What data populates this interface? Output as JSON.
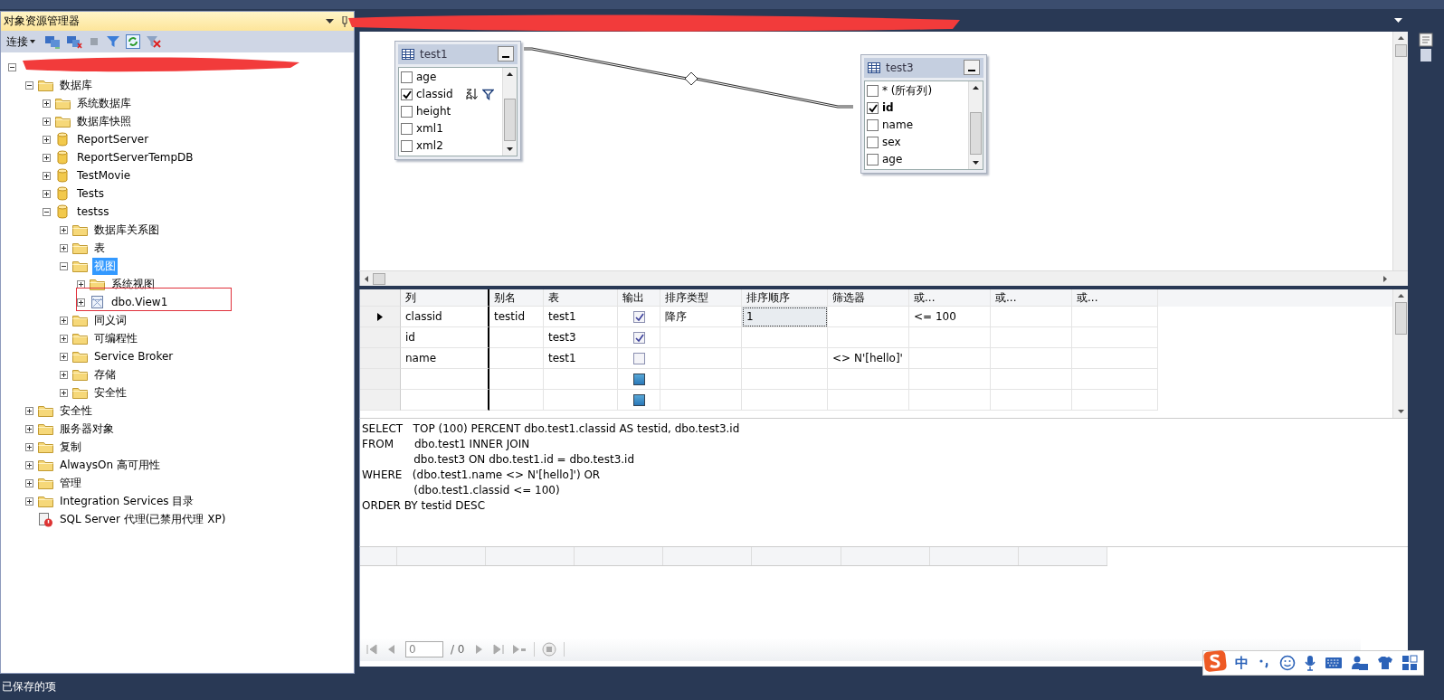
{
  "explorer": {
    "title": "对象资源管理器",
    "connect_label": "连接",
    "tree": [
      {
        "expanded": true,
        "children": [
          {
            "kind": "folder",
            "label": "数据库",
            "expanded": true,
            "selected": false,
            "children": [
              {
                "kind": "folder",
                "label": "系统数据库",
                "expanded": false,
                "selected": false
              },
              {
                "kind": "folder",
                "label": "数据库快照",
                "expanded": false,
                "selected": false
              },
              {
                "kind": "database",
                "label": "ReportServer",
                "expanded": false,
                "selected": false
              },
              {
                "kind": "database",
                "label": "ReportServerTempDB",
                "expanded": false,
                "selected": false
              },
              {
                "kind": "database",
                "label": "TestMovie",
                "expanded": false,
                "selected": false
              },
              {
                "kind": "database",
                "label": "Tests",
                "expanded": false,
                "selected": false
              },
              {
                "kind": "database",
                "label": "testss",
                "expanded": true,
                "selected": false,
                "children": [
                  {
                    "kind": "folder",
                    "label": "数据库关系图",
                    "expanded": false,
                    "selected": false
                  },
                  {
                    "kind": "folder",
                    "label": "表",
                    "expanded": false,
                    "selected": false
                  },
                  {
                    "kind": "folder",
                    "label": "视图",
                    "expanded": true,
                    "selected": true,
                    "children": [
                      {
                        "kind": "folder",
                        "label": "系统视图",
                        "expanded": false,
                        "selected": false
                      },
                      {
                        "kind": "view",
                        "label": "dbo.View1",
                        "expanded": false,
                        "selected": false,
                        "annotated": true
                      }
                    ]
                  },
                  {
                    "kind": "folder",
                    "label": "同义词",
                    "expanded": false,
                    "selected": false
                  },
                  {
                    "kind": "folder",
                    "label": "可编程性",
                    "expanded": false,
                    "selected": false
                  },
                  {
                    "kind": "folder",
                    "label": "Service Broker",
                    "expanded": false,
                    "selected": false
                  },
                  {
                    "kind": "folder",
                    "label": "存储",
                    "expanded": false,
                    "selected": false
                  },
                  {
                    "kind": "folder",
                    "label": "安全性",
                    "expanded": false,
                    "selected": false
                  }
                ]
              }
            ]
          },
          {
            "kind": "folder",
            "label": "安全性",
            "expanded": false,
            "selected": false
          },
          {
            "kind": "folder",
            "label": "服务器对象",
            "expanded": false,
            "selected": false
          },
          {
            "kind": "folder",
            "label": "复制",
            "expanded": false,
            "selected": false
          },
          {
            "kind": "folder",
            "label": "AlwaysOn 高可用性",
            "expanded": false,
            "selected": false
          },
          {
            "kind": "folder",
            "label": "管理",
            "expanded": false,
            "selected": false
          },
          {
            "kind": "folder",
            "label": "Integration Services 目录",
            "expanded": false,
            "selected": false
          },
          {
            "kind": "agent",
            "label": "SQL Server 代理(已禁用代理 XP)",
            "selected": false
          }
        ]
      }
    ]
  },
  "diagram": {
    "tables": [
      {
        "name": "test1",
        "columns": [
          {
            "name": "age",
            "checked": false,
            "key": false
          },
          {
            "name": "classid",
            "checked": true,
            "key": false,
            "sorted": true,
            "filtered": true
          },
          {
            "name": "height",
            "checked": false,
            "key": false
          },
          {
            "name": "xml1",
            "checked": false,
            "key": false
          },
          {
            "name": "xml2",
            "checked": false,
            "key": false
          }
        ]
      },
      {
        "name": "test3",
        "columns": [
          {
            "name": "* (所有列)",
            "checked": false,
            "key": false
          },
          {
            "name": "id",
            "checked": true,
            "key": true
          },
          {
            "name": "name",
            "checked": false,
            "key": false
          },
          {
            "name": "sex",
            "checked": false,
            "key": false
          },
          {
            "name": "age",
            "checked": false,
            "key": false
          }
        ]
      }
    ]
  },
  "grid": {
    "columns": [
      "列",
      "别名",
      "表",
      "输出",
      "排序类型",
      "排序顺序",
      "筛选器",
      "或...",
      "或...",
      "或..."
    ],
    "rows": [
      {
        "kind": "column",
        "selected": true,
        "column": "classid",
        "alias": "testid",
        "table": "test1",
        "output": true,
        "sort_type": "降序",
        "sort_order": "1",
        "sort_order_focused": true,
        "or_1": "<= 100"
      },
      {
        "kind": "column",
        "selected": false,
        "column": "id",
        "table": "test3",
        "output": true
      },
      {
        "kind": "column",
        "selected": false,
        "column": "name",
        "table": "test1",
        "output": false,
        "filter": "<> N'[hello]'"
      },
      {
        "kind": "new",
        "selected": false,
        "output": false
      },
      {
        "kind": "new",
        "selected": false,
        "output": false
      }
    ]
  },
  "sql": [
    "SELECT   TOP (100) PERCENT dbo.test1.classid AS testid, dbo.test3.id",
    "FROM      dbo.test1 INNER JOIN",
    "               dbo.test3 ON dbo.test1.id = dbo.test3.id",
    "WHERE   (dbo.test1.name <> N'[hello]') OR",
    "               (dbo.test1.classid <= 100)",
    "ORDER BY testid DESC"
  ],
  "results": {
    "page": "0",
    "page_total": "/ 0"
  },
  "ime": {
    "mode": "中"
  },
  "status_bar": "已保存的项"
}
